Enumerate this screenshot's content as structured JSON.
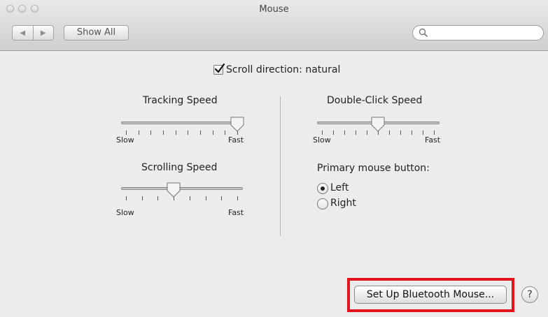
{
  "window": {
    "title": "Mouse",
    "show_all_label": "Show All",
    "search_placeholder": "",
    "back_glyph": "◀",
    "forward_glyph": "▶"
  },
  "scroll_direction": {
    "label": "Scroll direction: natural",
    "checked": true
  },
  "tracking_speed": {
    "title": "Tracking Speed",
    "min_label": "Slow",
    "max_label": "Fast",
    "tick_count": 10,
    "value_fraction": 1.0
  },
  "scrolling_speed": {
    "title": "Scrolling Speed",
    "min_label": "Slow",
    "max_label": "Fast",
    "tick_count": 8,
    "value_fraction": 0.43
  },
  "double_click_speed": {
    "title": "Double-Click Speed",
    "min_label": "Slow",
    "max_label": "Fast",
    "tick_count": 11,
    "value_fraction": 0.5
  },
  "primary_button": {
    "title": "Primary mouse button:",
    "options": [
      {
        "label": "Left",
        "selected": true
      },
      {
        "label": "Right",
        "selected": false
      }
    ]
  },
  "bluetooth_button_label": "Set Up Bluetooth Mouse...",
  "help_glyph": "?",
  "colors": {
    "highlight": "#e4141d",
    "window_bg": "#ececec"
  }
}
